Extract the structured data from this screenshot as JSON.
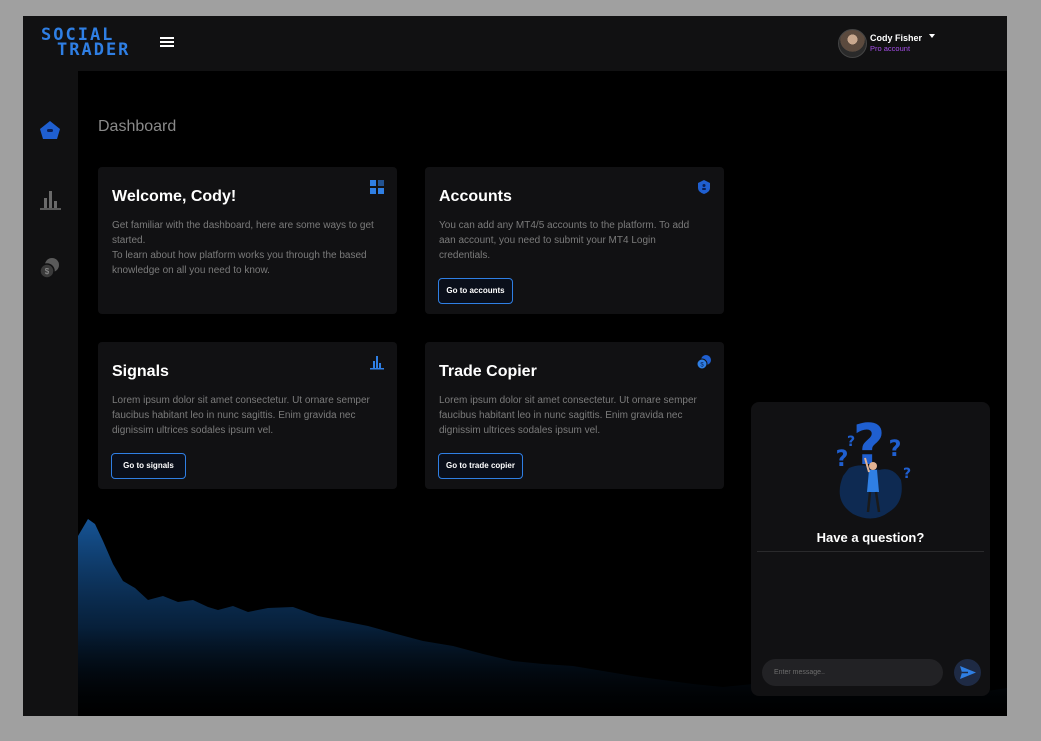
{
  "app": {
    "logo_line1": "SOCIAL",
    "logo_line2": "TRADER"
  },
  "user": {
    "name": "Cody Fisher",
    "role": "Pro account"
  },
  "sidebar": {
    "items": [
      {
        "name": "home",
        "icon": "home-icon",
        "active": true
      },
      {
        "name": "signals",
        "icon": "bar-chart-icon",
        "active": false
      },
      {
        "name": "trade-copier",
        "icon": "coins-icon",
        "active": false
      }
    ]
  },
  "page": {
    "title": "Dashboard"
  },
  "cards": {
    "welcome": {
      "title": "Welcome, Cody!",
      "text": "Get familiar with the dashboard, here are some ways to get started.\nTo learn about how platform works you through the based knowledge on all you need to know.",
      "icon": "grid-icon"
    },
    "accounts": {
      "title": "Accounts",
      "text": "You can add any MT4/5 accounts to the platform. To add aan account, you need to submit your MT4 Login credentials.",
      "button": "Go to accounts",
      "icon": "shield-icon"
    },
    "signals": {
      "title": "Signals",
      "text": "Lorem ipsum dolor sit amet consectetur. Ut ornare semper faucibus habitant leo in nunc sagittis. Enim gravida nec dignissim ultrices sodales ipsum vel.",
      "button": "Go to signals",
      "icon": "bar-chart-icon"
    },
    "trade_copier": {
      "title": "Trade Copier",
      "text": "Lorem ipsum dolor sit amet consectetur. Ut ornare semper faucibus habitant leo in nunc sagittis. Enim gravida nec dignissim ultrices sodales ipsum vel.",
      "button": "Go to trade copier",
      "icon": "coins-icon"
    }
  },
  "chat": {
    "title": "Have a question?",
    "placeholder": "Enter message..",
    "send_icon": "send-icon"
  },
  "colors": {
    "accent": "#2f7fe4",
    "role": "#a54ee8",
    "card_bg": "#111113",
    "bg": "#000000"
  }
}
